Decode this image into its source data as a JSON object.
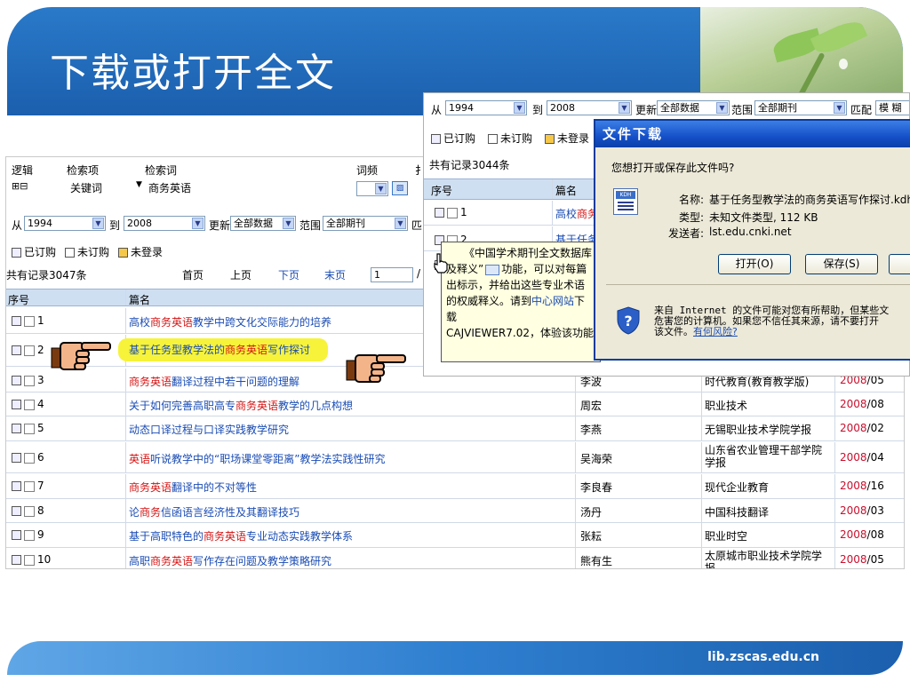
{
  "slide": {
    "title": "下载或打开全文",
    "footer_url": "lib.zscas.edu.cn"
  },
  "main": {
    "header_labels": {
      "logic": "逻辑",
      "field": "检索项",
      "term": "检索词",
      "freq": "词频",
      "cut": "扌"
    },
    "logic_controls": "⊞⊟",
    "field_select": "关键词",
    "term_value": "商务英语",
    "filter": {
      "from_label": "从",
      "from_value": "1994",
      "to_label": "到",
      "to_value": "2008",
      "update_label": "更新",
      "update_value": "全部数据",
      "scope_label": "范围",
      "scope_value": "全部期刊",
      "tail": "匹"
    },
    "legend": {
      "ordered": "已订购",
      "not_ordered": "未订购",
      "not_logged": "未登录"
    },
    "record_count": "共有记录3047条",
    "pager": {
      "first": "首页",
      "prev": "上页",
      "next": "下页",
      "last": "末页",
      "page": "1",
      "tail": "/"
    },
    "table_head": {
      "no": "序号",
      "title": "篇名"
    },
    "rows": [
      {
        "no": "1",
        "t1": "高校",
        "t2": "商务英语",
        "t3": "教学中跨文化交际能力的培养",
        "author": "",
        "journal": "",
        "year": "",
        "issue": ""
      },
      {
        "no": "2",
        "t1": "基于任务型教学法的",
        "t2": "商务英语",
        "t3": "写作探讨",
        "author": "",
        "journal": "",
        "year": "",
        "issue": ""
      },
      {
        "no": "3",
        "t1": "",
        "t2": "商务英语",
        "t3": "翻译过程中若干问题的理解",
        "author": "李波",
        "journal": "时代教育(教育教学版)",
        "year": "2008",
        "issue": "/05"
      },
      {
        "no": "4",
        "t1": "关于如何完善高职高专",
        "t2": "商务英语",
        "t3": "教学的几点构想",
        "author": "周宏",
        "journal": "职业技术",
        "year": "2008",
        "issue": "/08"
      },
      {
        "no": "5",
        "t1": "动态口译过程与口译实践教学研究",
        "t2": "",
        "t3": "",
        "author": "李燕",
        "journal": "无锡职业技术学院学报",
        "year": "2008",
        "issue": "/02"
      },
      {
        "no": "6",
        "t1": "",
        "t2": "英语",
        "t3": "听说教学中的“职场课堂零距离”教学法实践性研究",
        "author": "吴海荣",
        "journal": "山东省农业管理干部学院",
        "journal2": "学报",
        "year": "2008",
        "issue": "/04"
      },
      {
        "no": "7",
        "t1": "",
        "t2": "商务英语",
        "t3": "翻译中的不对等性",
        "author": "李良春",
        "journal": "现代企业教育",
        "year": "2008",
        "issue": "/16"
      },
      {
        "no": "8",
        "t1": "论",
        "t2": "商务",
        "t3": "信函语言经济性及其翻译技巧",
        "author": "汤丹",
        "journal": "中国科技翻译",
        "year": "2008",
        "issue": "/03"
      },
      {
        "no": "9",
        "t1": "基于高职特色的",
        "t2": "商务英语",
        "t3": "专业动态实践教学体系",
        "author": "张耘",
        "journal": "职业时空",
        "year": "2008",
        "issue": "/08"
      },
      {
        "no": "10",
        "t1": "高职",
        "t2": "商务英语",
        "t3": "写作存在问题及教学策略研究",
        "author": "熊有生",
        "journal": "太原城市职业技术学院学",
        "journal2": "报",
        "year": "2008",
        "issue": "/05"
      }
    ]
  },
  "overlay": {
    "filter": {
      "from_label": "从",
      "from_value": "1994",
      "to_label": "到",
      "to_value": "2008",
      "update_label": "更新",
      "update_value": "全部数据",
      "scope_label": "范围",
      "scope_value": "全部期刊",
      "match_label": "匹配",
      "match_value": "模 糊"
    },
    "legend": {
      "ordered": "已订购",
      "not_ordered": "未订购",
      "not_logged": "未登录"
    },
    "record_count": "共有记录3044条",
    "table_head": {
      "no": "序号",
      "title": "篇名"
    },
    "rows": [
      {
        "no": "1",
        "t1": "高校",
        "t2": "商务"
      },
      {
        "no": "2",
        "t1": "基于任务"
      }
    ]
  },
  "tooltip": {
    "line1": "《中国学术期刊全文数据库",
    "line2a": "及释义”",
    "line2b": "功能，可以对每篇",
    "line3": "出标示，并给出这些专业术语",
    "line4a": "的权威释义。请到",
    "line4b": "中心网站",
    "line4c": "下载",
    "line5": "CAJVIEWER7.02，体验该功能"
  },
  "dialog": {
    "title": "文件下载",
    "question": "您想打开或保存此文件吗?",
    "name_label": "名称:",
    "name_value": "基于任务型教学法的商务英语写作探讨.kdh",
    "type_label": "类型:",
    "type_value": "未知文件类型, 112 KB",
    "sender_label": "发送者:",
    "sender_value": "lst.edu.cnki.net",
    "open_btn": "打开(O)",
    "save_btn": "保存(S)",
    "warning1": "来自 Internet 的文件可能对您有所帮助，但某些文",
    "warning2": "危害您的计算机。如果您不信任其来源，请不要打开",
    "warning3": "该文件。",
    "risk_link": "有何风险?",
    "file_icon_label": "KDH"
  }
}
